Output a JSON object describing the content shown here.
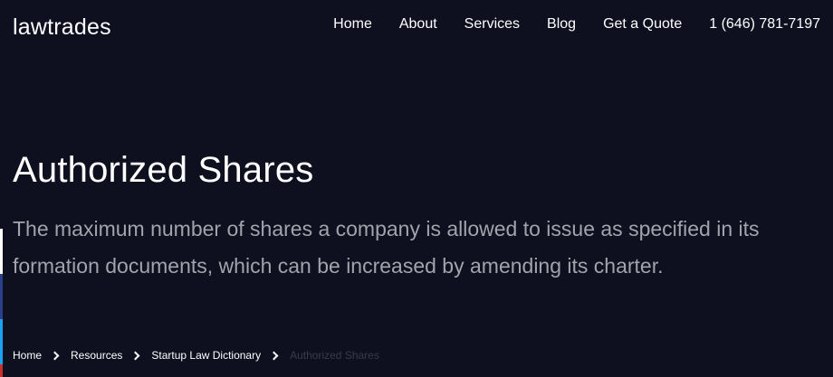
{
  "logo": {
    "text": "lawtrades"
  },
  "nav": {
    "items": [
      {
        "label": "Home"
      },
      {
        "label": "About"
      },
      {
        "label": "Services"
      },
      {
        "label": "Blog"
      },
      {
        "label": "Get a Quote"
      },
      {
        "label": "1 (646) 781-7197"
      }
    ]
  },
  "hero": {
    "title": "Authorized Shares",
    "description": "The maximum number of shares a company is allowed to issue as specified in its formation documents, which can be increased by amending its charter."
  },
  "breadcrumb": {
    "items": [
      {
        "label": "Home"
      },
      {
        "label": "Resources"
      },
      {
        "label": "Startup Law Dictionary"
      }
    ],
    "current": "Authorized Shares"
  },
  "colors": {
    "background": "#0e0f1f",
    "description_text": "#a2a3ab",
    "breadcrumb_current": "#3a3b4a"
  }
}
